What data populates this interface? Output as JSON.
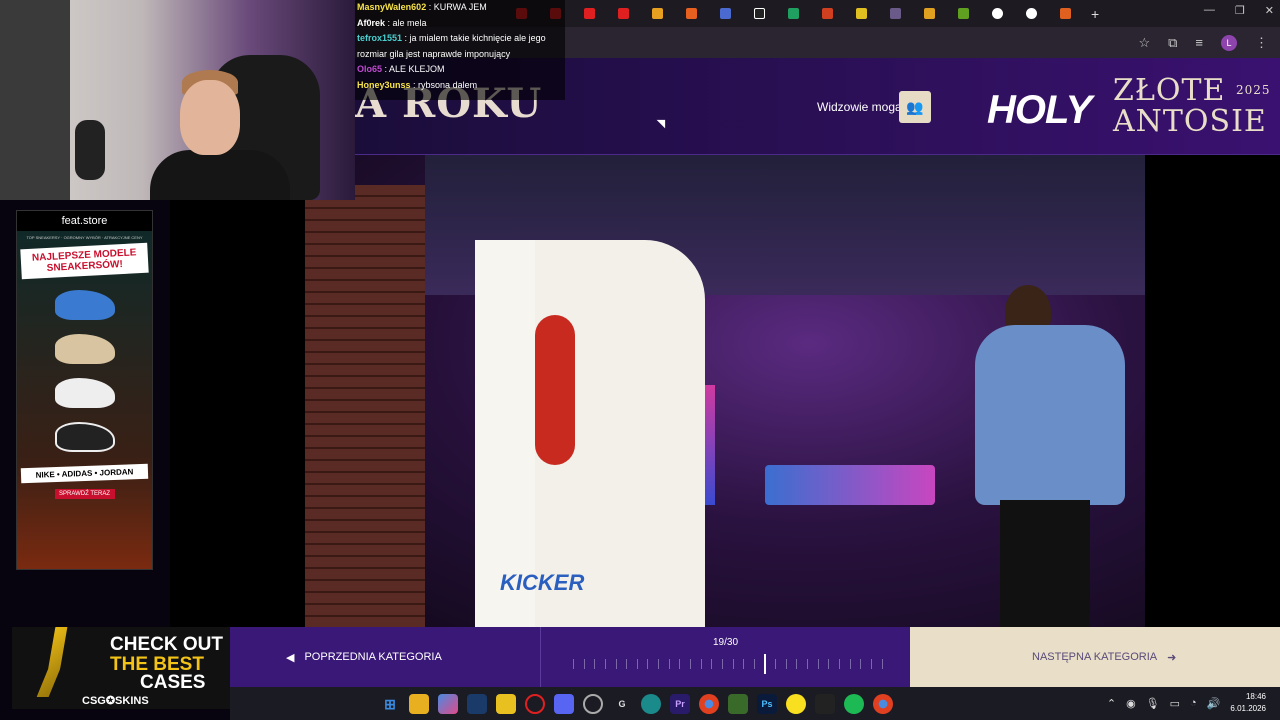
{
  "chat": {
    "messages": [
      {
        "user": "MasnyWalen602",
        "color": "#f7e34a",
        "text": "KURWA JEM"
      },
      {
        "user": "Af0rek",
        "color": "#ffffff",
        "text": "ale mela"
      },
      {
        "user": "tefrox1551",
        "color": "#4ad0d0",
        "text": "ja mialem takie kichnięcie ale jego rozmiar gila jest naprawde imponujący"
      },
      {
        "user": "Olo65",
        "color": "#c04ad0",
        "text": "ALE KLEJOM"
      },
      {
        "user": "Honey3unss",
        "color": "#f7e34a",
        "text": "rybsona dalem"
      }
    ],
    "sep": " : "
  },
  "header": {
    "roku": "A ROKU",
    "viewers_label": "Widzowie mogą",
    "holy": "HOLY",
    "zlote": "ZŁOTE",
    "year": "2025",
    "antosie": "ANTOSIE"
  },
  "ad": {
    "brand": "feat.store",
    "tagline": "TOP SNEAKERSY · OGROMNY WYBÓR · ATRAKCYJNE CENY",
    "headline": "NAJLEPSZE MODELE SNEAKERSÓW!",
    "brands": "NIKE • ADIDAS • JORDAN",
    "cta": "SPRAWDŹ TERAZ"
  },
  "video": {
    "label": "KICKER"
  },
  "sponsor": {
    "line1": "CHECK OUT",
    "line2": "THE BEST",
    "line3": "CASES",
    "logo": "CSG✪SKINS"
  },
  "nav": {
    "prev_label": "POPRZEDNIA KATEGORIA",
    "next_label": "NASTĘPNA KATEGORIA",
    "progress_label": "19/30",
    "progress_current": 19,
    "progress_total": 30
  },
  "taskbar": {
    "time": "18:46",
    "date": "6.01.2026"
  },
  "colors": {
    "header_purple": "#2a0f55",
    "nav_purple": "#3a1878",
    "cream": "#e9dfc8"
  }
}
